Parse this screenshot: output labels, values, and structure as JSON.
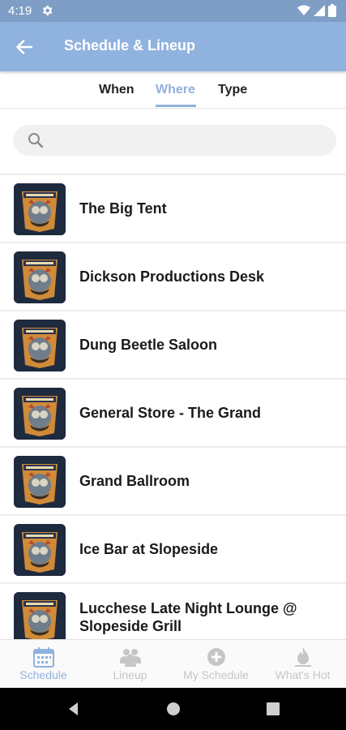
{
  "status_bar": {
    "time": "4:19"
  },
  "app_bar": {
    "title": "Schedule & Lineup"
  },
  "tabs": [
    {
      "label": "When",
      "active": false
    },
    {
      "label": "Where",
      "active": true
    },
    {
      "label": "Type",
      "active": false
    }
  ],
  "search": {
    "value": "",
    "placeholder": ""
  },
  "venues": [
    {
      "name": "The Big Tent"
    },
    {
      "name": "Dickson Productions Desk"
    },
    {
      "name": "Dung Beetle Saloon"
    },
    {
      "name": "General Store - The Grand"
    },
    {
      "name": "Grand Ballroom"
    },
    {
      "name": "Ice Bar at Slopeside"
    },
    {
      "name": "Lucchese Late Night Lounge @ Slopeside Grill"
    }
  ],
  "bottom_nav": [
    {
      "label": "Schedule",
      "icon": "calendar-icon",
      "active": true
    },
    {
      "label": "Lineup",
      "icon": "people-icon",
      "active": false
    },
    {
      "label": "My Schedule",
      "icon": "add-circle-icon",
      "active": false
    },
    {
      "label": "What's Hot",
      "icon": "flame-icon",
      "active": false
    }
  ],
  "colors": {
    "status_bar": "#7f9ec6",
    "app_bar": "#90b2de",
    "accent": "#90b2de",
    "inactive_nav": "#c6c6c6",
    "thumbnail_bg": "#1e2a3e"
  }
}
